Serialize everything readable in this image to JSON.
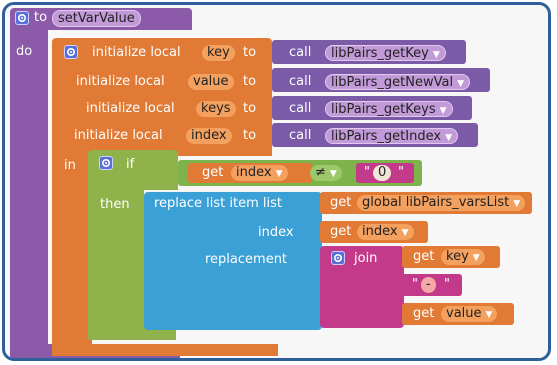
{
  "procedure": {
    "to_label": "to",
    "name": "setVarValue",
    "do_label": "do"
  },
  "locals": [
    {
      "prefix": "initialize local",
      "var": "key",
      "to_label": "to",
      "call_label": "call",
      "fn": "libPairs_getKey"
    },
    {
      "prefix": "initialize local",
      "var": "value",
      "to_label": "to",
      "call_label": "call",
      "fn": "libPairs_getNewVal"
    },
    {
      "prefix": "initialize local",
      "var": "keys",
      "to_label": "to",
      "call_label": "call",
      "fn": "libPairs_getKeys"
    },
    {
      "prefix": "initialize local",
      "var": "index",
      "to_label": "to",
      "call_label": "call",
      "fn": "libPairs_getIndex"
    }
  ],
  "in_label": "in",
  "if_block": {
    "if_label": "if",
    "get_label": "get",
    "var": "index",
    "op": "≠",
    "value": "0",
    "then_label": "then"
  },
  "replace_block": {
    "title": "replace list item  list",
    "list_get_label": "get",
    "list_var": "global libPairs_varsList",
    "index_label": "index",
    "index_get_label": "get",
    "index_var": "index",
    "replacement_label": "replacement"
  },
  "join_block": {
    "label": "join",
    "item1_get_label": "get",
    "item1_var": "key",
    "item2_text": "-",
    "item3_get_label": "get",
    "item3_var": "value"
  },
  "colors": {
    "procedure": "#8b5aa8",
    "local": "#e07a35",
    "call": "#7b5ba8",
    "control": "#8fb24a",
    "compare": "#7eb24a",
    "list": "#3aa0d6",
    "text": "#c43a8a",
    "frame": "#2f5f9a"
  }
}
